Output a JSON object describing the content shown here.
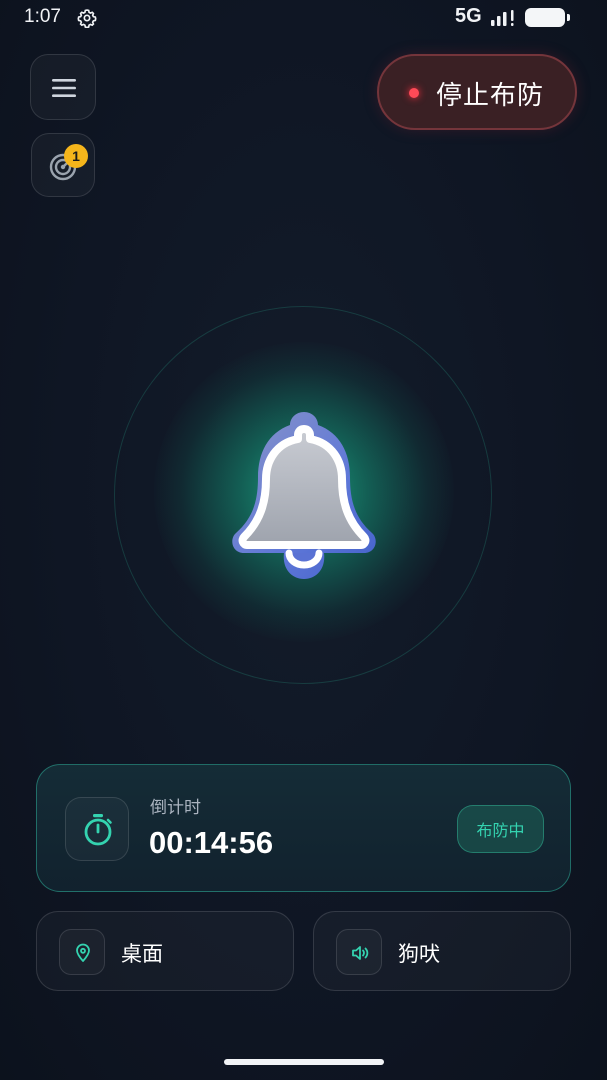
{
  "status_bar": {
    "time": "1:07",
    "network": "5G",
    "settings_icon": "gear-icon",
    "signal_icon": "signal-bars-icon",
    "battery_icon": "battery-icon"
  },
  "top_bar": {
    "menu_icon": "hamburger-menu-icon",
    "radar_icon": "radar-icon",
    "radar_badge": "1",
    "stop_button_label": "停止布防",
    "stop_indicator_color": "#ff4a57"
  },
  "center": {
    "alarm_icon": "bell-icon",
    "glow_color": "#1cb48c"
  },
  "countdown": {
    "label": "倒计时",
    "value": "00:14:56",
    "status": "布防中",
    "icon": "stopwatch-icon",
    "accent_color": "#34d3b0"
  },
  "location": {
    "label": "桌面",
    "icon": "location-pin-icon"
  },
  "sound": {
    "label": "狗吠",
    "icon": "speaker-icon"
  }
}
